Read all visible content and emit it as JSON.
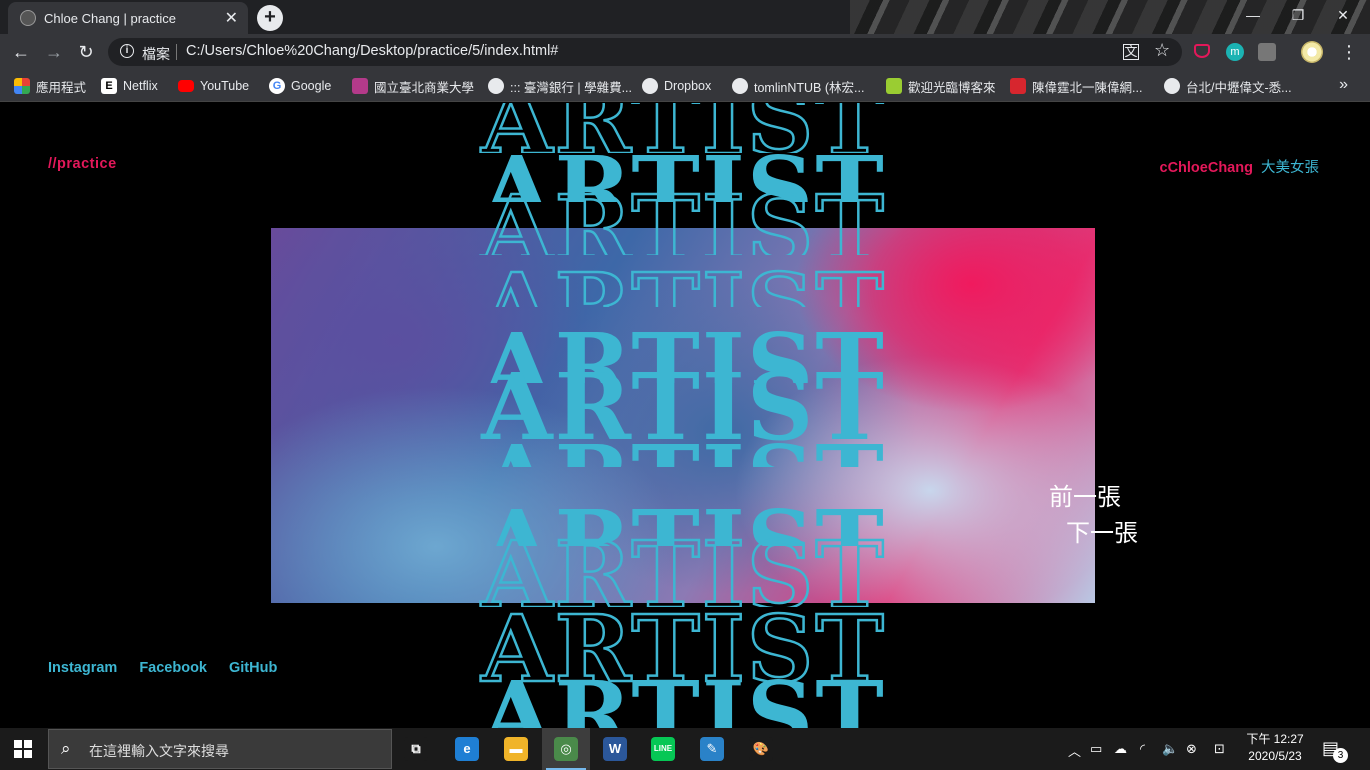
{
  "browser": {
    "tab_title": "Chloe Chang | practice",
    "tab_close": "✕",
    "new_tab": "+",
    "window_controls": [
      "—",
      "❐",
      "✕"
    ],
    "nav": {
      "back": "←",
      "forward": "→",
      "reload": "↻"
    },
    "address_label": "檔案",
    "address_url": "C:/Users/Chloe%20Chang/Desktop/practice/5/index.html#",
    "translate_icon": "translate-icon",
    "star": "☆",
    "menu": "⋮",
    "bookmarks": [
      {
        "label": "應用程式",
        "icon": "apps-icon",
        "color": "#e94235"
      },
      {
        "label": "Netflix",
        "icon": "netflix-icon",
        "color": "#ffffff"
      },
      {
        "label": "YouTube",
        "icon": "youtube-icon",
        "color": "#ff0000"
      },
      {
        "label": "Google",
        "icon": "google-icon",
        "color": "#ffffff"
      },
      {
        "label": "國立臺北商業大學",
        "icon": "ntub-icon",
        "color": "#b43a8a"
      },
      {
        "label": "::: 臺灣銀行 | 學雜費...",
        "icon": "globe-icon",
        "color": "#e8eaed"
      },
      {
        "label": "Dropbox",
        "icon": "globe-icon",
        "color": "#e8eaed"
      },
      {
        "label": "tomlinNTUB (林宏...",
        "icon": "github-icon",
        "color": "#e8eaed"
      },
      {
        "label": "歡迎光臨博客來",
        "icon": "books-icon",
        "color": "#9acd32"
      },
      {
        "label": "陳偉霆北一陳偉網...",
        "icon": "fan-icon",
        "color": "#d7262e"
      },
      {
        "label": "台北/中壢偉文-悉...",
        "icon": "globe-icon",
        "color": "#e8eaed"
      }
    ],
    "bookmarks_more": "»"
  },
  "page": {
    "nav_practice": "//practice",
    "brand_name": "cChloeChang",
    "brand_sub": "大美女張",
    "artist_word": "ARTIST",
    "prev_label": "前一張",
    "next_label": "下一張",
    "social": [
      "Instagram",
      "Facebook",
      "GitHub"
    ],
    "colors": {
      "accent_pink": "#e3185a",
      "accent_cyan": "#3db6d2",
      "background": "#000000"
    }
  },
  "taskbar": {
    "search_placeholder": "在這裡輸入文字來搜尋",
    "search_icon": "🔍",
    "clock_period_time": "下午 12:27",
    "clock_date": "2020/5/23",
    "notification_count": "3",
    "apps": [
      {
        "name": "task-view",
        "glyph": "⧉",
        "color": "#1b1b1b"
      },
      {
        "name": "edge",
        "glyph": "e",
        "color": "#1f7fd4"
      },
      {
        "name": "file-explorer",
        "glyph": "▬",
        "color": "#f0b429"
      },
      {
        "name": "chrome",
        "glyph": "◎",
        "color": "#4a8a4a"
      },
      {
        "name": "word",
        "glyph": "W",
        "color": "#2b579a"
      },
      {
        "name": "line",
        "glyph": "LINE",
        "color": "#06c755"
      },
      {
        "name": "pen-app",
        "glyph": "✎",
        "color": "#2a82c8"
      },
      {
        "name": "paint",
        "glyph": "🎨",
        "color": "#1b1b1b"
      }
    ]
  }
}
